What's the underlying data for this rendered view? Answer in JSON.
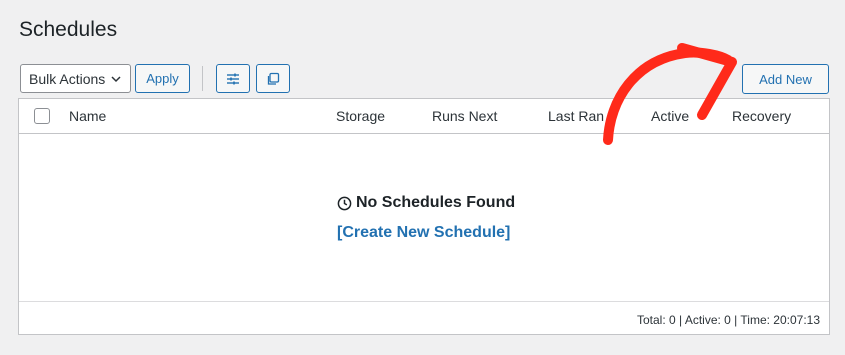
{
  "page": {
    "title": "Schedules"
  },
  "toolbar": {
    "bulk_actions": "Bulk Actions",
    "apply_label": "Apply",
    "settings_icon": "sliders-icon",
    "copy_icon": "copy-icon",
    "add_new_label": "Add New"
  },
  "table": {
    "columns": [
      "Name",
      "Storage",
      "Runs Next",
      "Last Ran",
      "Active",
      "Recovery"
    ]
  },
  "empty_state": {
    "icon": "clock-icon",
    "title": "No Schedules Found",
    "link_label": "[Create New Schedule]"
  },
  "status_bar": {
    "text": "Total: 0 | Active: 0 | Time: 20:07:13"
  },
  "colors": {
    "accent": "#2271b1",
    "annotation_arrow": "#ff2a1a",
    "background": "#f0f0f1"
  }
}
